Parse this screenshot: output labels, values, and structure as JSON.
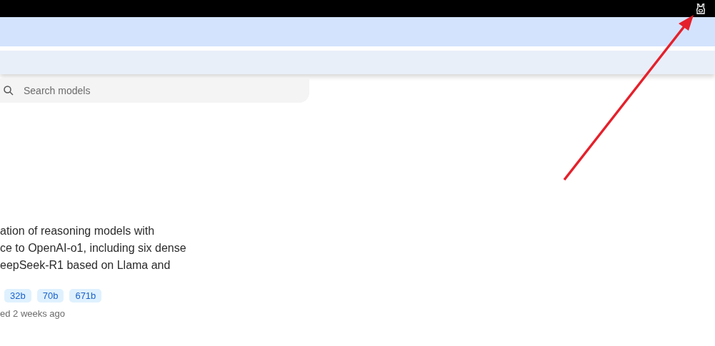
{
  "search": {
    "placeholder": "Search models"
  },
  "model": {
    "description_lines": [
      "ation of reasoning models with",
      "ce to OpenAI-o1, including six dense",
      "eepSeek-R1 based on Llama and"
    ],
    "tags": [
      "32b",
      "70b",
      "671b"
    ],
    "updated": "ed 2 weeks ago"
  }
}
